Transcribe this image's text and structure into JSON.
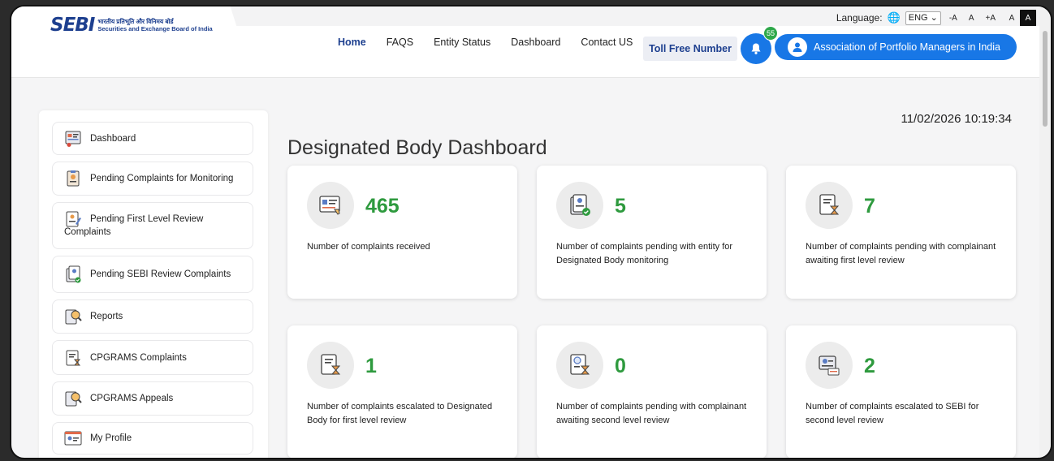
{
  "topbar": {
    "language_label": "Language:",
    "language_value": "ENG",
    "font_small": "-A",
    "font_normal": "A",
    "font_large": "+A",
    "contrast_light": "A",
    "contrast_dark": "A"
  },
  "header": {
    "logo_mark": "SEBI",
    "logo_line1": "भारतीय प्रतिभूति और विनिमय बोर्ड",
    "logo_line2": "Securities and Exchange Board of India",
    "nav": [
      "Home",
      "FAQS",
      "Entity Status",
      "Dashboard",
      "Contact US"
    ],
    "toll_free": "Toll Free Number",
    "notification_count": "55",
    "user_name": "Association of Portfolio Managers in India"
  },
  "sidebar": {
    "items": [
      {
        "label": "Dashboard",
        "icon": "dashboard-icon"
      },
      {
        "label": "Pending Complaints for Monitoring",
        "icon": "monitor-icon"
      },
      {
        "label_line1": "Pending First Level Review",
        "label_line2": "Complaints",
        "icon": "review-icon"
      },
      {
        "label": "Pending SEBI Review Complaints",
        "icon": "sebi-review-icon"
      },
      {
        "label": "Reports",
        "icon": "reports-icon"
      },
      {
        "label": "CPGRAMS Complaints",
        "icon": "cpgrams-icon"
      },
      {
        "label": "CPGRAMS Appeals",
        "icon": "appeals-icon"
      },
      {
        "label": "My Profile",
        "icon": "profile-icon"
      }
    ]
  },
  "main": {
    "datetime": "11/02/2026 10:19:34",
    "title": "Designated Body Dashboard",
    "cards": [
      {
        "value": "465",
        "label": "Number of complaints received",
        "icon": "complaints-received-icon"
      },
      {
        "value": "5",
        "label": "Number of complaints pending with entity for Designated Body monitoring",
        "icon": "pending-entity-icon"
      },
      {
        "value": "7",
        "label": "Number of complaints pending with complainant awaiting first level review",
        "icon": "hourglass-doc-icon"
      },
      {
        "value": "1",
        "label": "Number of complaints escalated to Designated Body for first level review",
        "icon": "hourglass-doc-icon"
      },
      {
        "value": "0",
        "label": "Number of complaints pending with complainant awaiting second level review",
        "icon": "search-hourglass-icon"
      },
      {
        "value": "2",
        "label": "Number of complaints escalated to SEBI for second level review",
        "icon": "escalate-icon"
      }
    ]
  },
  "colors": {
    "brand": "#1d3f8f",
    "accent": "#1877e6",
    "success": "#2e9a3e"
  }
}
